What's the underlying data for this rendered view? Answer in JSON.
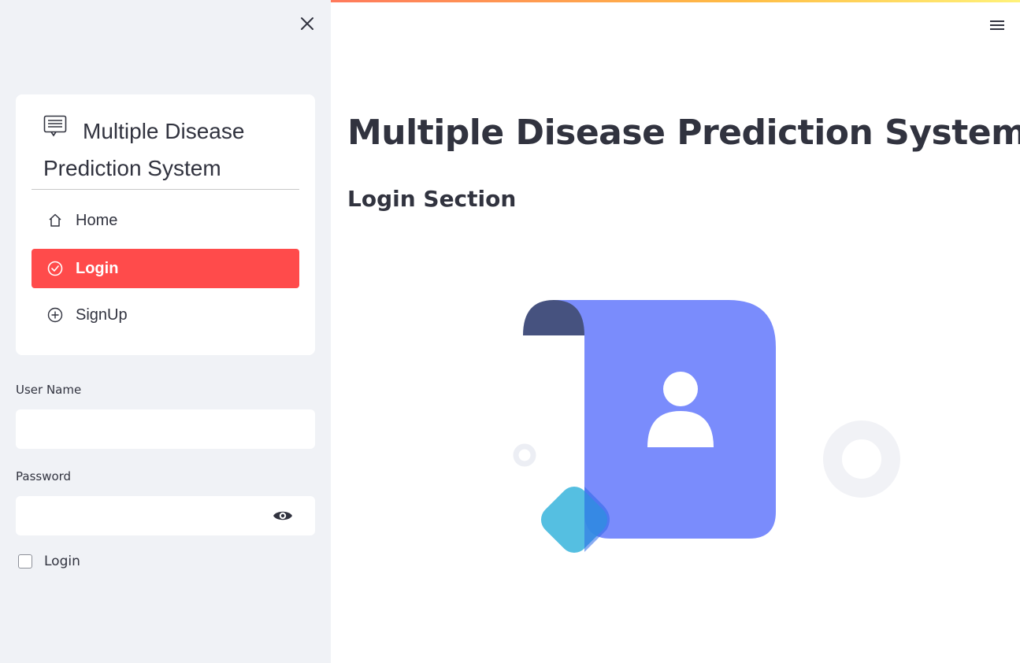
{
  "sidebar": {
    "menu": {
      "title": "Multiple Disease Prediction System",
      "title_icon": "list-icon",
      "items": [
        {
          "label": "Home",
          "icon": "house-icon",
          "active": false
        },
        {
          "label": "Login",
          "icon": "check-circle-icon",
          "active": true
        },
        {
          "label": "SignUp",
          "icon": "plus-circle-icon",
          "active": false
        }
      ],
      "accent_color": "#ff4b4b"
    },
    "username": {
      "label": "User Name",
      "value": "",
      "placeholder": ""
    },
    "password": {
      "label": "Password",
      "value": "",
      "placeholder": ""
    },
    "login_checkbox": {
      "label": "Login",
      "checked": false
    }
  },
  "main": {
    "title": "Multiple Disease Prediction System",
    "subtitle": "Login Section",
    "illustration": "user-profile-document-illustration"
  }
}
